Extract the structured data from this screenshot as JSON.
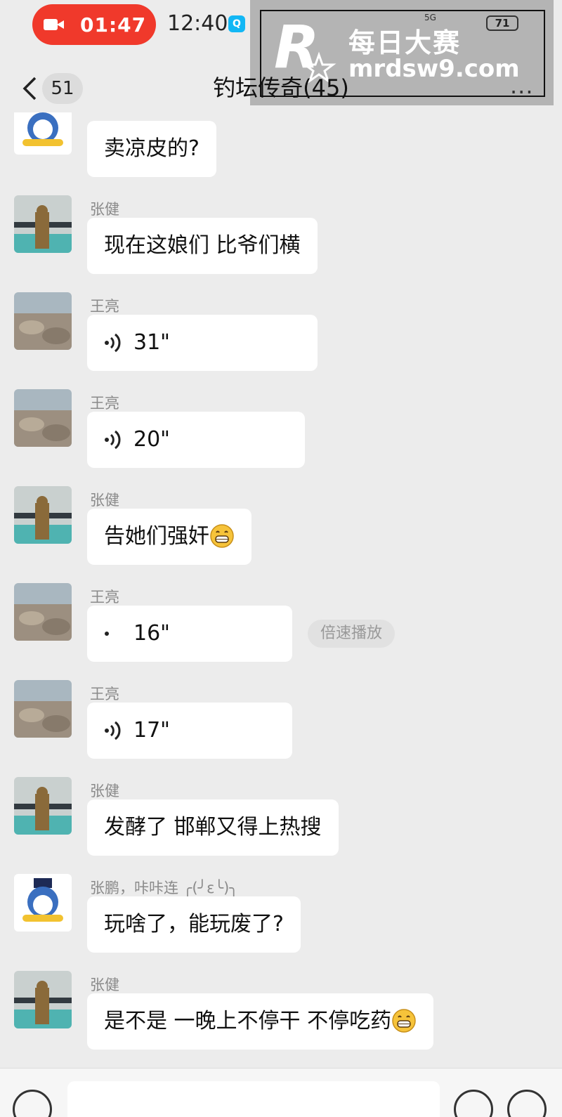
{
  "status_bar": {
    "recording_time": "01:47",
    "clock": "12:40",
    "signal_text": "5G",
    "battery": "71"
  },
  "watermark": {
    "logo_letter": "R",
    "name": "每日大赛",
    "url": "mrdsw9.com"
  },
  "header": {
    "back_count": "51",
    "title": "钓坛传奇(45)",
    "more": "···"
  },
  "messages": [
    {
      "sender": "",
      "text": "卖凉皮的?",
      "type": "text",
      "avatar": "cartoon"
    },
    {
      "sender": "张健",
      "text": "现在这娘们 比爷们横",
      "type": "text",
      "avatar": "man"
    },
    {
      "sender": "王亮",
      "text": "31\"",
      "type": "voice",
      "avatar": "rocks"
    },
    {
      "sender": "王亮",
      "text": "20\"",
      "type": "voice",
      "avatar": "rocks"
    },
    {
      "sender": "张健",
      "text": "告她们强奸",
      "type": "text",
      "emoji": "grin",
      "avatar": "man"
    },
    {
      "sender": "王亮",
      "text": "16\"",
      "type": "voice",
      "playing": true,
      "speed_label": "倍速播放",
      "avatar": "rocks"
    },
    {
      "sender": "王亮",
      "text": "17\"",
      "type": "voice",
      "avatar": "rocks"
    },
    {
      "sender": "张健",
      "text": "发酵了  邯郸又得上热搜",
      "type": "text",
      "avatar": "man"
    },
    {
      "sender": "张鹏，咔咔连 ╭(╯ε╰)╮",
      "text": "玩啥了，能玩废了?",
      "type": "text",
      "avatar": "cartoon"
    },
    {
      "sender": "张健",
      "text": "是不是 一晚上不停干  不停吃药",
      "type": "text",
      "emoji": "grin",
      "avatar": "man"
    }
  ]
}
